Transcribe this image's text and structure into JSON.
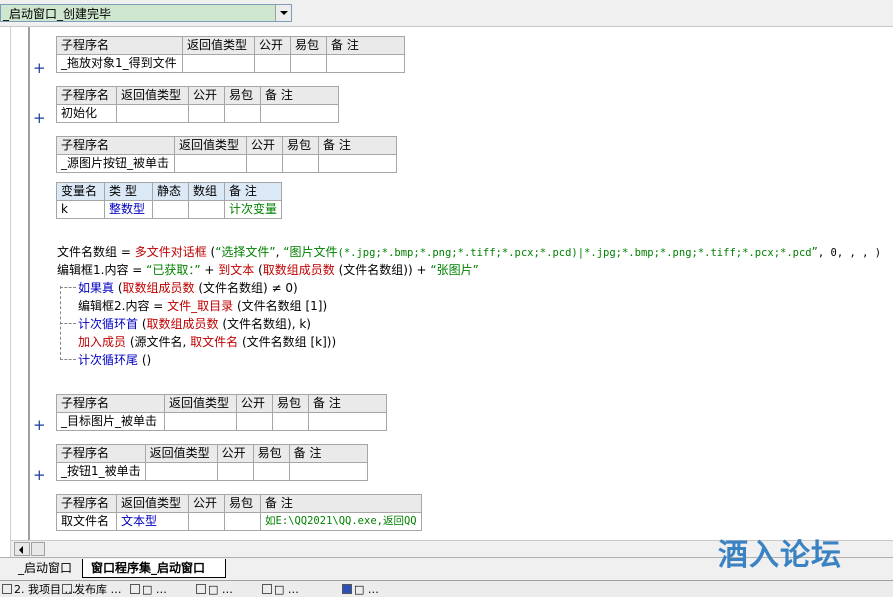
{
  "window": {
    "combo_value": "_启动窗口_创建完毕"
  },
  "subs": [
    {
      "headers": [
        "子程序名",
        "返回值类型",
        "公开",
        "易包",
        "备 注"
      ],
      "name": "_拖放对象1_得到文件",
      "expander": "+"
    },
    {
      "headers": [
        "子程序名",
        "返回值类型",
        "公开",
        "易包",
        "备 注"
      ],
      "name": "初始化",
      "expander": "+"
    },
    {
      "headers": [
        "子程序名",
        "返回值类型",
        "公开",
        "易包",
        "备 注"
      ],
      "name": "_源图片按钮_被单击"
    },
    {
      "headers": [
        "子程序名",
        "返回值类型",
        "公开",
        "易包",
        "备 注"
      ],
      "name": "_目标图片_被单击",
      "expander": "+"
    },
    {
      "headers": [
        "子程序名",
        "返回值类型",
        "公开",
        "易包",
        "备 注"
      ],
      "name": "_按钮1_被单击",
      "expander": "+"
    },
    {
      "headers": [
        "子程序名",
        "返回值类型",
        "公开",
        "易包",
        "备 注"
      ],
      "name": "取文件名",
      "return_type": "文本型",
      "note": "如E:\\QQ2021\\QQ.exe,返回QQ"
    }
  ],
  "vars": {
    "headers": [
      "变量名",
      "类 型",
      "静态",
      "数组",
      "备 注"
    ],
    "name": "k",
    "type": "整数型",
    "note": "计次变量"
  },
  "code": {
    "l1_var": "文件名数组",
    "l1_eq": " = ",
    "l1_fn": "多文件对话框",
    "l1_open": " (",
    "l1_s1": "“选择文件”",
    "l1_comma": ", ",
    "l1_s2a": "“图片文件",
    "l1_s2b": "(*.jpg;*.bmp;*.png;*.tiff;*.pcx;*.pcd)|*.jpg;*.bmp;*.png;*.tiff;*.pcx;*.pcd",
    "l1_s2c": "”",
    "l1_tail": ", 0, , , )",
    "l2_var": "编辑框1.内容",
    "l2_eq": " = ",
    "l2_s1": "“已获取：”",
    "l2_plus1": " + ",
    "l2_fn1": "到文本",
    "l2_open": " (",
    "l2_fn2": "取数组成员数",
    "l2_arg": " (文件名数组)) ",
    "l2_plus2": "+ ",
    "l2_s2": "“张图片”",
    "l3_kw": "如果真",
    "l3_open": " (",
    "l3_fn": "取数组成员数",
    "l3_rest": " (文件名数组) ≠ 0)",
    "l4_var": "编辑框2.内容",
    "l4_eq": " = ",
    "l4_fn": "文件_取目录",
    "l4_rest": " (文件名数组 [1])",
    "l5_kw": "计次循环首",
    "l5_open": " (",
    "l5_fn": "取数组成员数",
    "l5_rest": " (文件名数组), k)",
    "l6_kw": "加入成员",
    "l6_open": " (源文件名, ",
    "l6_fn": "取文件名",
    "l6_rest": " (文件名数组 [k]))",
    "l7_kw": "计次循环尾",
    "l7_rest": " ()"
  },
  "tabs": [
    "_启动窗口",
    "窗口程序集_启动窗口"
  ],
  "watermark": "酒入论坛",
  "status": [
    "2. 我项目 …",
    "发布库 …",
    "□ …",
    "□ …",
    "□ …",
    "□ …"
  ]
}
